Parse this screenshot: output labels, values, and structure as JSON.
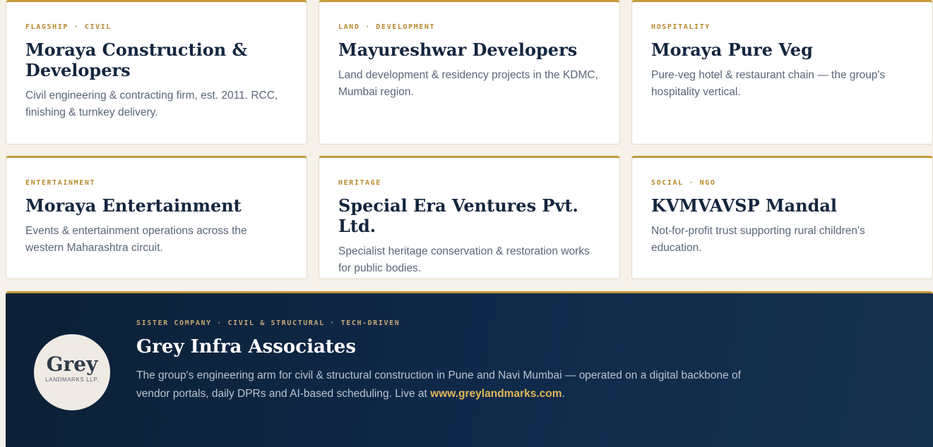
{
  "cards": [
    {
      "tag": "FLAGSHIP · CIVIL",
      "title": "Moraya Construction & Developers",
      "desc": "Civil engineering & contracting firm, est. 2011. RCC, finishing & turnkey delivery."
    },
    {
      "tag": "LAND · DEVELOPMENT",
      "title": "Mayureshwar Developers",
      "desc": "Land development & residency projects in the KDMC, Mumbai region."
    },
    {
      "tag": "HOSPITALITY",
      "title": "Moraya Pure Veg",
      "desc": "Pure-veg hotel & restaurant chain — the group's hospitality vertical."
    },
    {
      "tag": "ENTERTAINMENT",
      "title": "Moraya Entertainment",
      "desc": "Events & entertainment operations across the western Maharashtra circuit."
    },
    {
      "tag": "HERITAGE",
      "title": "Special Era Ventures Pvt. Ltd.",
      "desc": "Specialist heritage conservation & restoration works for public bodies."
    },
    {
      "tag": "SOCIAL · NGO",
      "title": "KVMVAVSP Mandal",
      "desc": "Not-for-profit trust supporting rural children's education."
    }
  ],
  "banner": {
    "logo_word": "Grey",
    "logo_sub": "LANDMARKS LLP.",
    "tag": "SISTER COMPANY · CIVIL & STRUCTURAL · TECH-DRIVEN",
    "title": "Grey Infra Associates",
    "desc": "The group's engineering arm for civil & structural construction in Pune and Navi Mumbai — operated on a digital backbone of vendor portals, daily DPRs and AI-based scheduling. Live at ",
    "link": "www.greylandmarks.com",
    "desc_end": "."
  },
  "colors": {
    "accent_gold": "#c49a3c",
    "navy": "#0b2036",
    "card_title": "#14263f"
  }
}
